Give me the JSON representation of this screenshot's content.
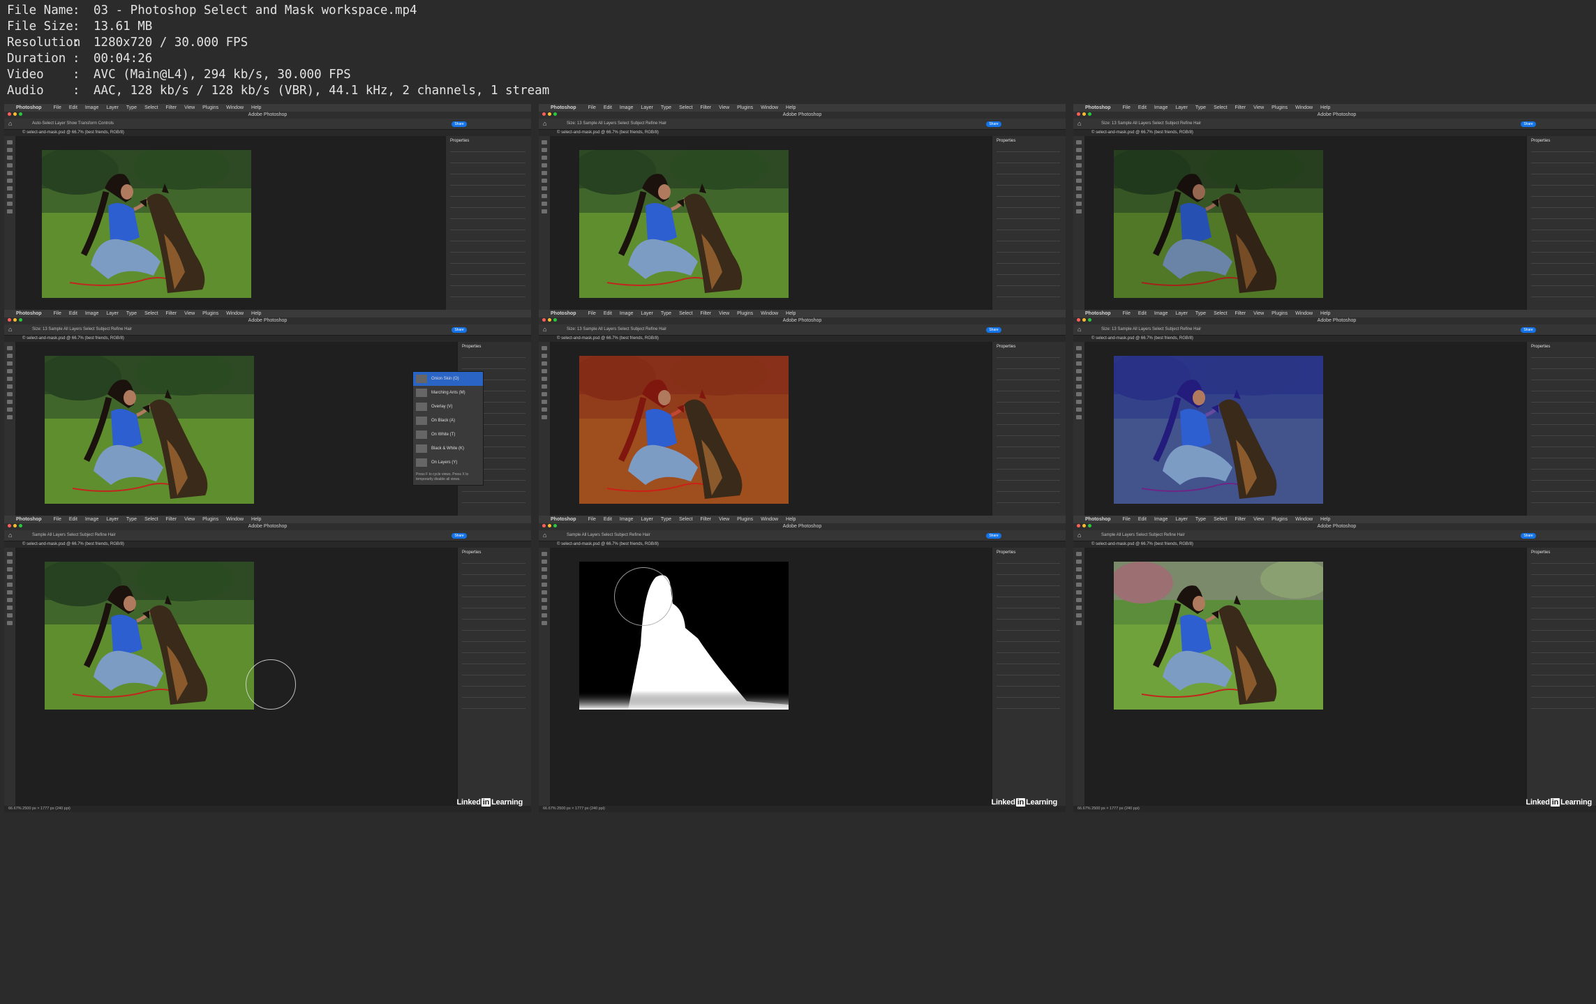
{
  "file_info": [
    {
      "key": "File Name",
      "value": "03 - Photoshop Select and Mask workspace.mp4"
    },
    {
      "key": "File Size",
      "value": "13.61 MB"
    },
    {
      "key": "Resolution",
      "value": "1280x720 / 30.000 FPS"
    },
    {
      "key": "Duration",
      "value": "00:04:26"
    },
    {
      "key": "Video",
      "value": "AVC (Main@L4), 294 kb/s, 30.000 FPS"
    },
    {
      "key": "Audio",
      "value": "AAC, 128 kb/s / 128 kb/s (VBR), 44.1 kHz, 2 channels, 1 stream"
    }
  ],
  "app": {
    "name": "Photoshop",
    "window_title": "Adobe Photoshop",
    "document_tab": "© select-and-mask.psd @ 66.7% (best friends, RGB/8)",
    "menus": [
      "File",
      "Edit",
      "Image",
      "Layer",
      "Type",
      "Select",
      "Filter",
      "View",
      "Plugins",
      "Window",
      "Help"
    ],
    "share_label": "Share",
    "status_text": "66.67%  2500 px × 1777 px (240 ppi)",
    "watermark_prefix": "Linked",
    "watermark_in": "in",
    "watermark_suffix": "Learning"
  },
  "frames": [
    {
      "panel_title": "Properties",
      "options": "Auto-Select  Layer  Show Transform Controls",
      "overlay": "none"
    },
    {
      "panel_title": "Properties",
      "options": "Size: 13  Sample All Layers  Select Subject  Refine Hair",
      "overlay": "none"
    },
    {
      "panel_title": "Properties",
      "options": "Size: 13  Sample All Layers  Select Subject  Refine Hair",
      "overlay": "dim"
    },
    {
      "panel_title": "Properties",
      "options": "Size: 13  Sample All Layers  Select Subject  Refine Hair",
      "overlay": "dropdown"
    },
    {
      "panel_title": "Properties",
      "options": "Size: 13  Sample All Layers  Select Subject  Refine Hair",
      "overlay": "red"
    },
    {
      "panel_title": "Properties",
      "options": "Size: 13  Sample All Layers  Select Subject  Refine Hair",
      "overlay": "blue"
    },
    {
      "panel_title": "Properties",
      "options": "Sample All Layers  Select Subject  Refine Hair",
      "overlay": "brush"
    },
    {
      "panel_title": "Properties",
      "options": "Sample All Layers  Select Subject  Refine Hair",
      "overlay": "mask"
    },
    {
      "panel_title": "Properties",
      "options": "Sample All Layers  Select Subject  Refine Hair",
      "overlay": "park"
    }
  ],
  "view_mode_menu": {
    "items": [
      "Onion Skin (O)",
      "Marching Ants (M)",
      "Overlay (V)",
      "On Black (A)",
      "On White (T)",
      "Black & White (K)",
      "On Layers (Y)"
    ],
    "hint": "Press F to cycle views. Press X to temporarily disable all views."
  },
  "colors": {
    "overlay_red": "#d41c10",
    "overlay_blue": "#2a25d8",
    "accent": "#1473e6"
  }
}
